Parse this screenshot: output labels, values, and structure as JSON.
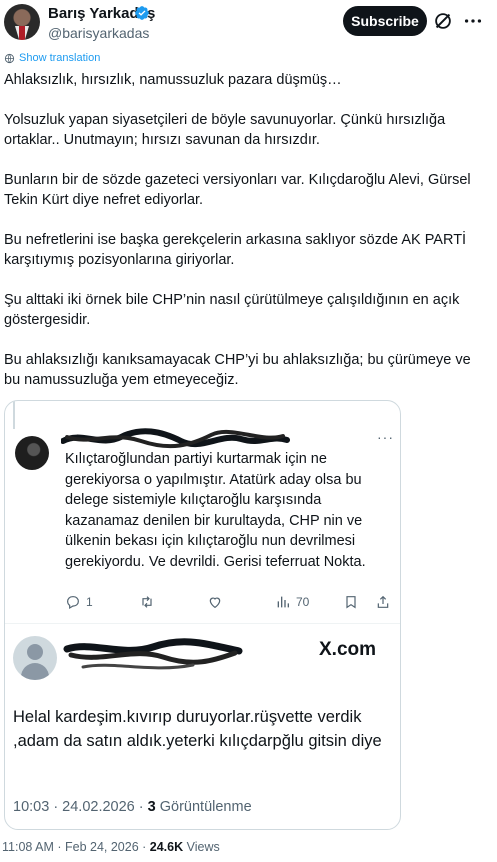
{
  "author": {
    "name": "Barış Yarkadaş",
    "handle": "@barisyarkadas",
    "verified_color": "#1d9bf0"
  },
  "header": {
    "subscribe_label": "Subscribe",
    "grok_icon": "grok-icon",
    "more_icon": "more-icon"
  },
  "translate": {
    "label": "Show translation",
    "icon": "globe-icon"
  },
  "tweet": {
    "paragraphs": [
      "Ahlaksızlık, hırsızlık, namussuzluk pazara düşmüş…",
      "Yolsuzluk yapan siyasetçileri de böyle savunuyorlar. Çünkü hırsızlığa ortaklar.. Unutmayın; hırsızı savunan da hırsızdır.",
      "Bunların bir de sözde gazeteci versiyonları var. Kılıçdaroğlu Alevi, Gürsel Tekin Kürt diye nefret ediyorlar.",
      "Bu nefretlerini ise başka gerekçelerin arkasına saklıyor sözde AK PARTİ karşıtıymış pozisyonlarına giriyorlar.",
      "Şu alttaki iki örnek bile CHP’nin nasıl çürütülmeye çalışıldığının en açık göstergesidir.",
      "Bu ahlaksızlığı kanıksamayacak CHP’yi bu ahlaksızlığa; bu çürümeye ve bu namussuzluğa yem etmeyeceğiz."
    ]
  },
  "screenshot_card": {
    "reply": {
      "text": "Kılıçtaroğlundan partiyi kurtarmak için ne gerekiyorsa o yapılmıştır. Atatürk aday olsa bu delege sistemiyle kılıçtaroğlu karşısında kazanamaz denilen bir kurultayda, CHP nin ve ülkenin bekası için kılıçtaroğlu nun devrilmesi gerekiyordu. Ve devrildi. Gerisi teferruat Nokta.",
      "more": "···",
      "actions": {
        "reply_count": "1",
        "retweet_count": "",
        "like_count": "",
        "views_count": "70"
      }
    },
    "post": {
      "brand": "X.com",
      "text": "Helal kardeşim.kıvırıp duruyorlar.rüşvette verdik ,adam da satın aldık.yeterki kılıçdarpğlu gitsin diye",
      "time_date": "10:03 · 24.02.2026 · ",
      "views_number": "3",
      "views_label": " Görüntülenme"
    }
  },
  "footer": {
    "time_date": "11:08 AM · Feb 24, 2026 · ",
    "views_number": "24.6K",
    "views_label": " Views"
  }
}
